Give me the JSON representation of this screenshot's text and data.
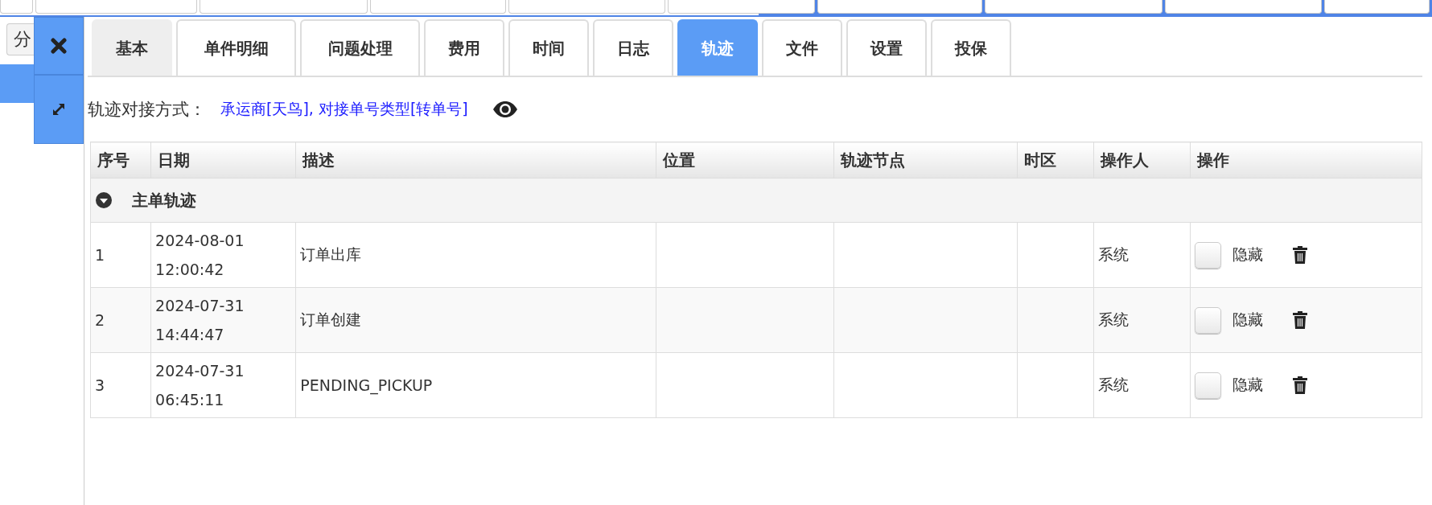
{
  "left_panel": {
    "button_text": "分"
  },
  "toolbar": {
    "buttons": [
      {
        "kind": "close"
      },
      {
        "kind": "expand"
      }
    ]
  },
  "tabs": [
    {
      "label": "基本",
      "selected": false
    },
    {
      "label": "单件明细",
      "selected": false
    },
    {
      "label": "问题处理",
      "selected": false
    },
    {
      "label": "费用",
      "selected": false
    },
    {
      "label": "时间",
      "selected": false
    },
    {
      "label": "日志",
      "selected": false
    },
    {
      "label": "轨迹",
      "selected": true
    },
    {
      "label": "文件",
      "selected": false
    },
    {
      "label": "设置",
      "selected": false
    },
    {
      "label": "投保",
      "selected": false
    }
  ],
  "track_source": {
    "label": "轨迹对接方式：",
    "value": "承运商[天鸟], 对接单号类型[转单号]"
  },
  "table": {
    "columns": [
      "序号",
      "日期",
      "描述",
      "位置",
      "轨迹节点",
      "时区",
      "操作人",
      "操作"
    ],
    "group": {
      "title": "主单轨迹",
      "expanded": true
    },
    "rows": [
      {
        "no": "1",
        "date": "2024-08-01",
        "time": "12:00:42",
        "description": "订单出库",
        "location": "",
        "node": "",
        "timezone": "",
        "operator": "系统",
        "hidden": false,
        "hide_label": "隐藏"
      },
      {
        "no": "2",
        "date": "2024-07-31",
        "time": "14:44:47",
        "description": "订单创建",
        "location": "",
        "node": "",
        "timezone": "",
        "operator": "系统",
        "hidden": false,
        "hide_label": "隐藏"
      },
      {
        "no": "3",
        "date": "2024-07-31",
        "time": "06:45:11",
        "description": "PENDING_PICKUP",
        "location": "",
        "node": "",
        "timezone": "",
        "operator": "系统",
        "hidden": false,
        "hide_label": "隐藏"
      }
    ]
  }
}
